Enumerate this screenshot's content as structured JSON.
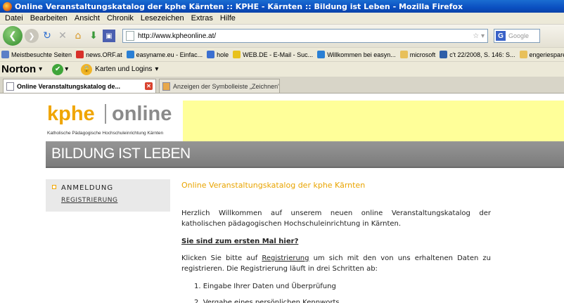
{
  "window": {
    "title": "Online Veranstaltungskatalog der kphe Kärnten :: KPHE - Kärnten :: Bildung ist Leben - Mozilla Firefox"
  },
  "menu": [
    "Datei",
    "Bearbeiten",
    "Ansicht",
    "Chronik",
    "Lesezeichen",
    "Extras",
    "Hilfe"
  ],
  "navigation": {
    "url": "http://www.kpheonline.at/",
    "search_placeholder": "Google"
  },
  "bookmarks": [
    {
      "label": "Meistbesuchte Seiten",
      "color": "#5b7fc7"
    },
    {
      "label": "news.ORF.at",
      "color": "#d8312a"
    },
    {
      "label": "easyname.eu - Einfac...",
      "color": "#2a7fd4"
    },
    {
      "label": "hole",
      "color": "#3b6fd0"
    },
    {
      "label": "WEB.DE - E-Mail - Suc...",
      "color": "#e8c21c"
    },
    {
      "label": "Willkommen bei easyn...",
      "color": "#2a7fd4"
    },
    {
      "label": "microsoft",
      "color": "#e8c05a"
    },
    {
      "label": "c't 22/2008, S. 146: S...",
      "color": "#2f5fa8"
    },
    {
      "label": "engeriesparen hausis...",
      "color": "#e8c05a"
    }
  ],
  "norton": {
    "brand": "Norton",
    "logins_label": "Karten und Logins"
  },
  "tabs": [
    {
      "label": "Online Veranstaltungskatalog de..."
    },
    {
      "label": "Anzeigen der Symbolleiste „Zeichnen\" - ..."
    }
  ],
  "page": {
    "logo_kphe": "kphe",
    "logo_online": "online",
    "logo_subtitle": "Katholische Pädagogische Hochschuleinrichtung Kärnten",
    "slogan": "BILDUNG IST LEBEN",
    "sidebar": {
      "anmeldung": "ANMELDUNG",
      "registrierung": "REGISTRIERUNG"
    },
    "heading": "Online Veranstaltungskatalog der kphe Kärnten",
    "welcome": "Herzlich Willkommen auf unserem neuen online Veranstaltungskatalog der katholischen pädagogischen Hochschuleinrichtung in Kärnten.",
    "subheading": "Sie sind zum ersten Mal hier?",
    "instr_before": "Klicken Sie bitte auf ",
    "instr_link": "Registrierung",
    "instr_after": " um sich mit den von uns erhaltenen Daten zu registrieren. Die Registrierung läuft in drei Schritten ab:",
    "steps": [
      "1.  Eingabe Ihrer Daten und Überprüfung",
      "2.  Vergabe eines persönlichen Kennworts"
    ]
  }
}
